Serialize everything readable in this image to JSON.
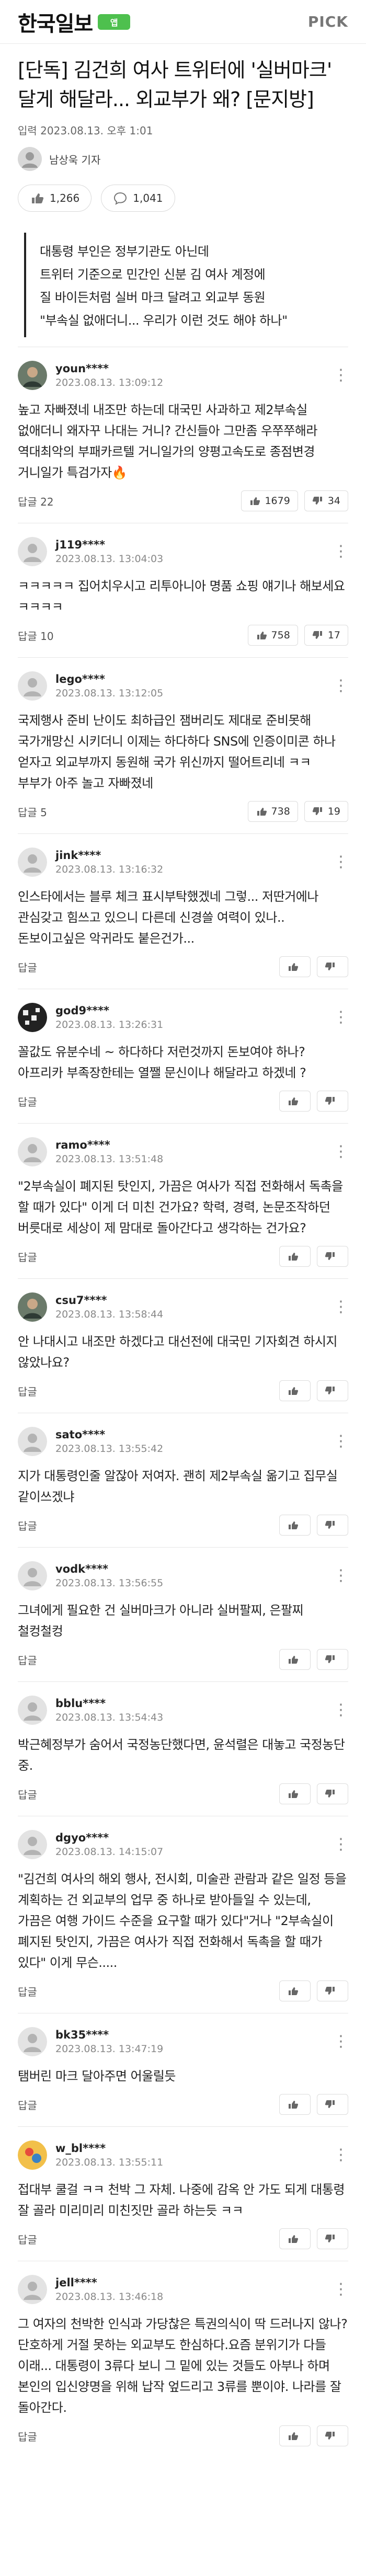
{
  "header": {
    "brand": "한국일보",
    "brand_badge": "앱",
    "pick": "PICK"
  },
  "article": {
    "title": "[단독] 김건희 여사 트위터에 '실버마크' 달게 해달라... 외교부가 왜? [문지방]",
    "date": "입력 2023.08.13. 오후 1:01",
    "reporter": "남상욱 기자",
    "like_count": "1,266",
    "comment_count": "1,041",
    "summary": [
      "대통령 부인은 정부기관도 아닌데",
      "트위터 기준으로 민간인 신분 김 여사 계정에",
      "질 바이든처럼 실버 마크 달려고 외교부 동원",
      "\"부속실 없애더니... 우리가 이런 것도 해야 하나\""
    ]
  },
  "labels": {
    "reply": "답글"
  },
  "comments": [
    {
      "user": "youn****",
      "time": "2023.08.13. 13:09:12",
      "text": "높고 자빠졌네 내조만 하는데 대국민 사과하고 제2부속실 없애더니 왜자꾸 나대는 거니? 간신들아 그만좀 우쭈쭈해라 역대최악의 부패카르텔 거니일가의 양평고속도로 종점변경 거니일가 특검가자🔥",
      "replies": "22",
      "up": "1679",
      "down": "34",
      "avatar": "photo-dark"
    },
    {
      "user": "j119****",
      "time": "2023.08.13. 13:04:03",
      "text": "ㅋㅋㅋㅋㅋ 집어치우시고 리투아니아 명품 쇼핑 얘기나 해보세요 ㅋㅋㅋㅋ",
      "replies": "10",
      "up": "758",
      "down": "17",
      "avatar": "default"
    },
    {
      "user": "lego****",
      "time": "2023.08.13. 13:12:05",
      "text": "국제행사 준비 난이도 최하급인 잼버리도 제대로 준비못해 국가개망신 시키더니 이제는 하다하다 SNS에 인증이미콘 하나 얻자고 외교부까지 동원해 국가 위신까지 떨어트리네 ㅋㅋ 부부가 아주 놀고 자빠졌네",
      "replies": "5",
      "up": "738",
      "down": "19",
      "avatar": "default"
    },
    {
      "user": "jink****",
      "time": "2023.08.13. 13:16:32",
      "text": "인스타에서는 블루 체크 표시부탁했겠네 그렇... 저딴거에나 관심갖고 힘쓰고 있으니 다른데 신경쓸 여력이 있나.. 돈보이고싶은 악귀라도 붙은건가...",
      "replies": "",
      "up": "",
      "down": "",
      "avatar": "default"
    },
    {
      "user": "god9****",
      "time": "2023.08.13. 13:26:31",
      "text": "꼴값도 유분수네 ~ 하다하다 저런것까지 돈보여야 하나? 아프리카 부족장한테는 열쨀 문신이나 해달라고 하겠네 ?",
      "replies": "",
      "up": "",
      "down": "",
      "avatar": "photo-pattern"
    },
    {
      "user": "ramo****",
      "time": "2023.08.13. 13:51:48",
      "text": "\"2부속실이 폐지된 탓인지, 가끔은 여사가 직접 전화해서 독촉을 할 때가 있다\" 이게 더 미친 건가요? 학력, 경력, 논문조작하던 버릇대로 세상이 제 맘대로 돌아간다고 생각하는 건가요?",
      "replies": "",
      "up": "",
      "down": "",
      "avatar": "default"
    },
    {
      "user": "csu7****",
      "time": "2023.08.13. 13:58:44",
      "text": "안 나대시고 내조만 하겠다고 대선전에 대국민 기자회견 하시지 않았나요?",
      "replies": "",
      "up": "",
      "down": "",
      "avatar": "photo-dark"
    },
    {
      "user": "sato****",
      "time": "2023.08.13. 13:55:42",
      "text": "지가 대통령인줄 알잖아 저여자. 괜히 제2부속실 옮기고 집무실 같이쓰겠냐",
      "replies": "",
      "up": "",
      "down": "",
      "avatar": "default"
    },
    {
      "user": "vodk****",
      "time": "2023.08.13. 13:56:55",
      "text": "그녀에게 필요한 건 실버마크가 아니라 실버팔찌, 은팔찌 철컹철컹",
      "replies": "",
      "up": "",
      "down": "",
      "avatar": "default"
    },
    {
      "user": "bblu****",
      "time": "2023.08.13. 13:54:43",
      "text": "박근혜정부가 숨어서 국정농단했다면, 윤석렬은 대놓고 국정농단 중.",
      "replies": "",
      "up": "",
      "down": "",
      "avatar": "default"
    },
    {
      "user": "dgyo****",
      "time": "2023.08.13. 14:15:07",
      "text": "\"김건희 여사의 해외 행사, 전시회, 미술관 관람과 같은 일정 등을 계획하는 건 외교부의 업무 중 하나로 받아들일 수 있는데, 가끔은 여행 가이드 수준을 요구할 때가 있다\"거나 \"2부속실이 폐지된 탓인지, 가끔은 여사가 직접 전화해서 독촉을 할 때가 있다\" 이게 무슨.....",
      "replies": "",
      "up": "",
      "down": "",
      "avatar": "default"
    },
    {
      "user": "bk35****",
      "time": "2023.08.13. 13:47:19",
      "text": "탬버린 마크 달아주면 어울릴듯",
      "replies": "",
      "up": "",
      "down": "",
      "avatar": "default"
    },
    {
      "user": "w_bl****",
      "time": "2023.08.13. 13:55:11",
      "text": "접대부 쿨걸 ㅋㅋ 천박 그 자체. 나중에 감옥 안 가도 되게 대통령 잘 골라 미리미리 미친짓만 골라 하는듯 ㅋㅋ",
      "replies": "",
      "up": "",
      "down": "",
      "avatar": "photo-color"
    },
    {
      "user": "jell****",
      "time": "2023.08.13. 13:46:18",
      "text": "그 여자의 천박한 인식과 가당찮은 특권의식이 딱 드러나지 않나? 단호하게 거절 못하는 외교부도 한심하다.요즘 분위기가 다들 이래... 대통령이 3류다 보니 그 밑에 있는 것들도 아부나 하며 본인의 입신양명을 위해 납작 엎드리고 3류를 뿐이야. 나라를 잘 돌아간다.",
      "replies": "",
      "up": "",
      "down": "",
      "avatar": "default"
    }
  ],
  "colors": {
    "brand_badge": "#4ec04e",
    "fire": "#ff6a00",
    "muted": "#888888"
  }
}
